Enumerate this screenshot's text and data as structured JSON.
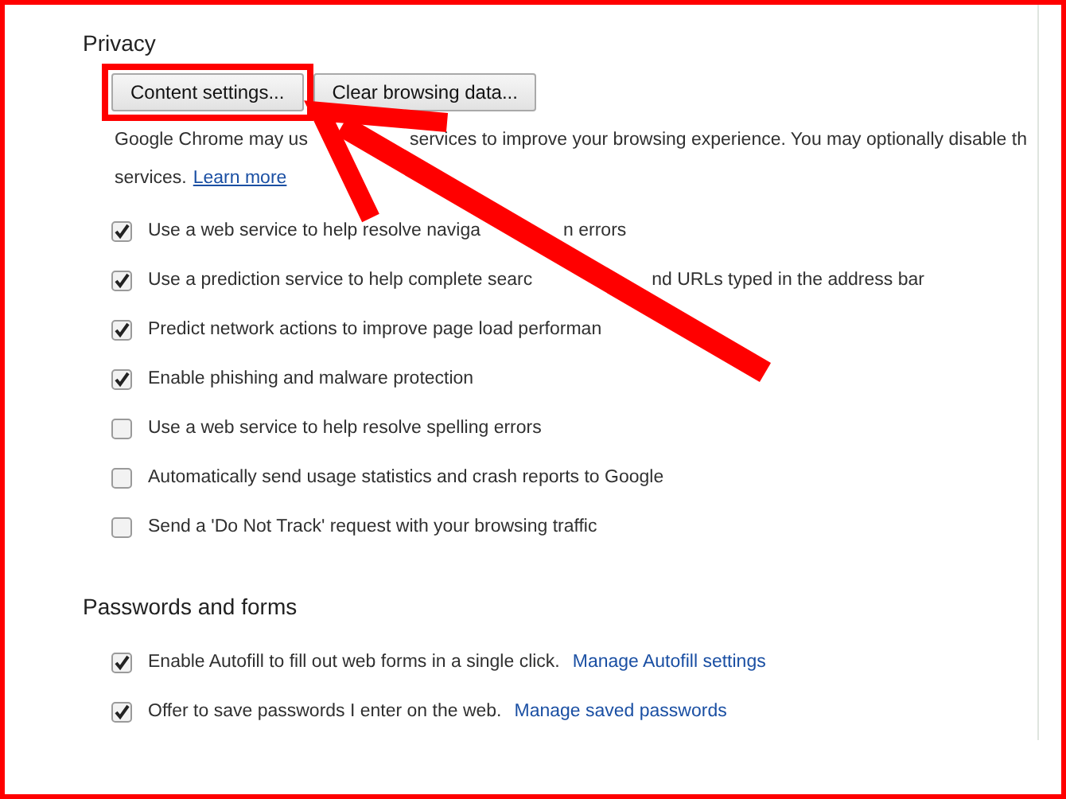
{
  "sections": [
    {
      "title": "Privacy",
      "buttons": [
        {
          "label": "Content settings...",
          "highlighted": true
        },
        {
          "label": "Clear browsing data...",
          "highlighted": false
        }
      ],
      "description": {
        "lines": [
          {
            "parts": [
              "Google Chrome may us",
              "services to improve your browsing experience. You may optionally disable th"
            ]
          },
          {
            "parts": [
              "services."
            ],
            "link": "Learn more"
          }
        ]
      },
      "options": [
        {
          "parts": [
            "Use a web service to help resolve naviga",
            "n errors"
          ],
          "checked": true
        },
        {
          "parts": [
            "Use a prediction service to help complete searc",
            "nd URLs typed in the address bar"
          ],
          "checked": true
        },
        {
          "parts": [
            "Predict network actions to improve page load performan"
          ],
          "checked": true
        },
        {
          "parts": [
            "Enable phishing and malware protection"
          ],
          "checked": true
        },
        {
          "parts": [
            "Use a web service to help resolve spelling errors"
          ],
          "checked": false
        },
        {
          "parts": [
            "Automatically send usage statistics and crash reports to Google"
          ],
          "checked": false
        },
        {
          "parts": [
            "Send a 'Do Not Track' request with your browsing traffic"
          ],
          "checked": false
        }
      ]
    },
    {
      "title": "Passwords and forms",
      "options": [
        {
          "parts": [
            "Enable Autofill to fill out web forms in a single click."
          ],
          "link": "Manage Autofill settings",
          "checked": true
        },
        {
          "parts": [
            "Offer to save passwords I enter on the web."
          ],
          "link": "Manage saved passwords",
          "checked": true
        }
      ]
    }
  ]
}
